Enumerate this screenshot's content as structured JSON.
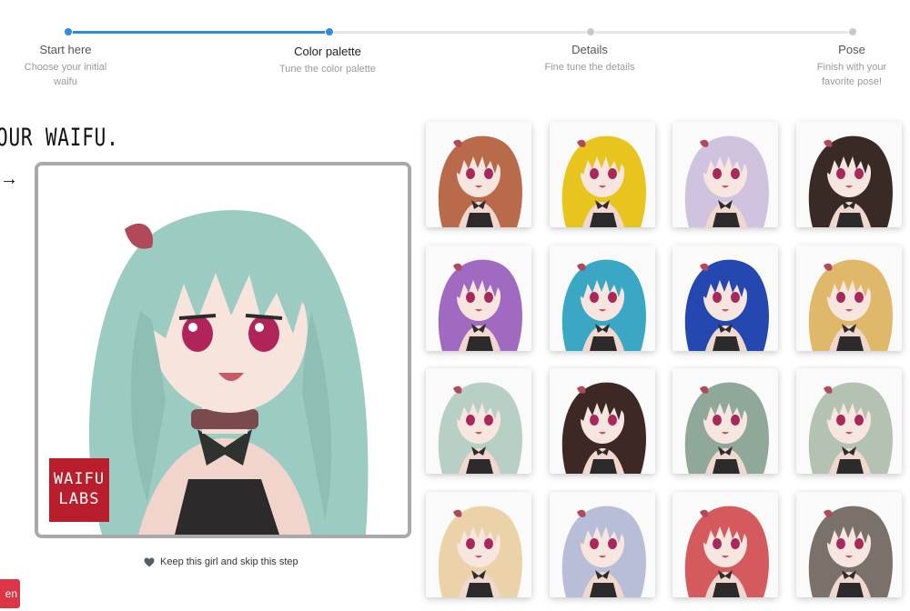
{
  "stepper": {
    "steps": [
      {
        "title": "Start here",
        "subtitle_line1": "Choose your initial",
        "subtitle_line2": "waifu",
        "state": "done"
      },
      {
        "title": "Color palette",
        "subtitle_line1": "Tune the color palette",
        "subtitle_line2": "",
        "state": "current"
      },
      {
        "title": "Details",
        "subtitle_line1": "Fine tune the details",
        "subtitle_line2": "",
        "state": "upcoming"
      },
      {
        "title": "Pose",
        "subtitle_line1": "Finish with your",
        "subtitle_line2": "favorite pose!",
        "state": "upcoming"
      }
    ],
    "accent_color": "#2b8be6"
  },
  "heading": {
    "text": "OUR WAIFU.",
    "arrow": "→"
  },
  "main_portrait": {
    "hair_color": "#9ccbc2",
    "logo_line1": "WAIFU",
    "logo_line2": "LABS"
  },
  "keep": {
    "label": "Keep this girl and skip this step",
    "icon": "heart-icon"
  },
  "action_button": {
    "label": "en"
  },
  "palette_options": [
    {
      "hair": "#b86a4a",
      "icon": "portrait-option"
    },
    {
      "hair": "#e8c41e",
      "icon": "portrait-option"
    },
    {
      "hair": "#cfc3e0",
      "icon": "portrait-option"
    },
    {
      "hair": "#3a2a26",
      "icon": "portrait-option"
    },
    {
      "hair": "#a06ac0",
      "icon": "portrait-option"
    },
    {
      "hair": "#3aa8c4",
      "icon": "portrait-option"
    },
    {
      "hair": "#2448b0",
      "icon": "portrait-option"
    },
    {
      "hair": "#e0b86a",
      "icon": "portrait-option"
    },
    {
      "hair": "#b8cfc6",
      "icon": "portrait-option"
    },
    {
      "hair": "#3e2824",
      "icon": "portrait-option"
    },
    {
      "hair": "#8fa89a",
      "icon": "portrait-option"
    },
    {
      "hair": "#b4c2b2",
      "icon": "portrait-option"
    },
    {
      "hair": "#ecd2a8",
      "icon": "portrait-option"
    },
    {
      "hair": "#b8bed8",
      "icon": "portrait-option"
    },
    {
      "hair": "#d45a5e",
      "icon": "portrait-option"
    },
    {
      "hair": "#7a726a",
      "icon": "portrait-option"
    }
  ]
}
